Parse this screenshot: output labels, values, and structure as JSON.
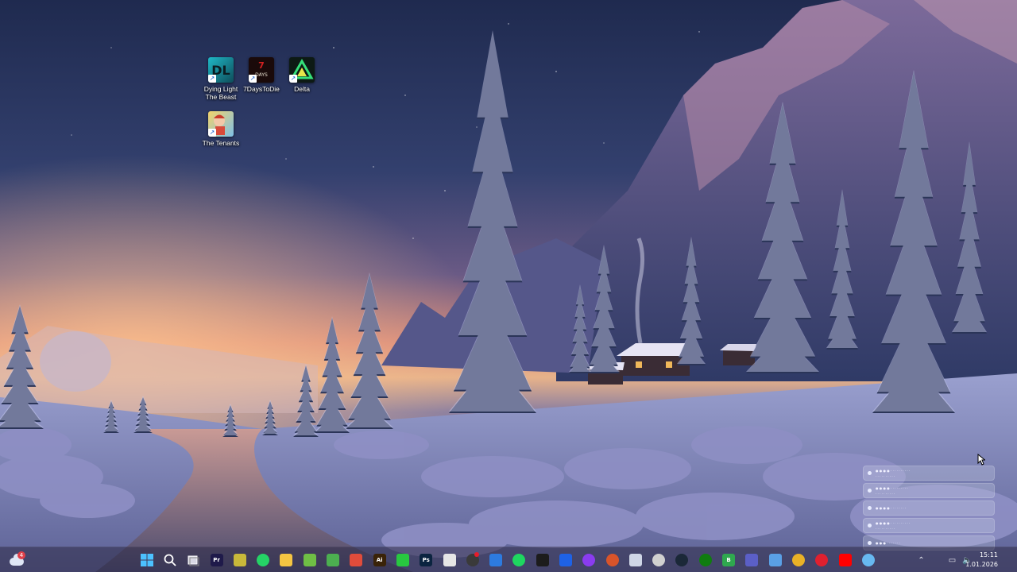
{
  "desktop": {
    "icons": [
      {
        "label": "Dying Light\nThe Beast",
        "label_line1": "Dying Light",
        "label_line2": "The Beast",
        "icon": "dying-light-icon"
      },
      {
        "label": "7DaysToDie",
        "icon": "7-days-to-die-icon"
      },
      {
        "label": "Delta",
        "icon": "delta-icon"
      },
      {
        "label": "The Tenants",
        "icon": "the-tenants-icon"
      }
    ]
  },
  "notifications": {
    "rows": [
      {
        "line1": "● ● ● ● · · · · · · · · · ·",
        "line2": "· · · · · · · · · ·"
      },
      {
        "line1": "● ● ● ● · · · · · · · · ·",
        "line2": "· · · · · · · · · ·"
      },
      {
        "line1": "● ● ● ● · · · · · · · ·",
        "line2": ""
      },
      {
        "line1": "● ● ● ● · · · · · · · · · ·",
        "line2": "· · · · · · · · · ·"
      },
      {
        "line1": "● ● ● · · · · · · ·",
        "line2": ""
      }
    ]
  },
  "taskbar": {
    "weather_badge": "4",
    "pinned": [
      {
        "name": "start-icon",
        "color": "#3fa4f0",
        "text": ""
      },
      {
        "name": "search-icon",
        "color": "transparent",
        "text": ""
      },
      {
        "name": "task-view-icon",
        "color": "transparent",
        "text": ""
      },
      {
        "name": "premiere-pro-icon",
        "color": "#1f1a4a",
        "text": "Pr"
      },
      {
        "name": "app-green-icon",
        "color": "#c9b93a",
        "text": ""
      },
      {
        "name": "whatsapp-icon",
        "color": "#25d366",
        "text": ""
      },
      {
        "name": "file-explorer-icon",
        "color": "#f5c542",
        "text": ""
      },
      {
        "name": "xbox-game-icon",
        "color": "#6fbf45",
        "text": ""
      },
      {
        "name": "app-lime-icon",
        "color": "#4caf50",
        "text": ""
      },
      {
        "name": "app-red-icon",
        "color": "#e04c3b",
        "text": ""
      },
      {
        "name": "illustrator-icon",
        "color": "#3a2308",
        "text": "Ai"
      },
      {
        "name": "phone-link-icon",
        "color": "#28c840",
        "text": ""
      },
      {
        "name": "photoshop-icon",
        "color": "#0b2440",
        "text": "Ps"
      },
      {
        "name": "app-document-icon",
        "color": "#e6e6e6",
        "text": ""
      },
      {
        "name": "app-dark-icon",
        "color": "#3a3a3a",
        "text": ""
      },
      {
        "name": "app-blue-icon",
        "color": "#2d7be0",
        "text": ""
      },
      {
        "name": "spotify-icon",
        "color": "#1ed760",
        "text": ""
      },
      {
        "name": "capcut-icon",
        "color": "#1c1c1c",
        "text": ""
      },
      {
        "name": "app-dropbox-icon",
        "color": "#1e62e6",
        "text": ""
      },
      {
        "name": "app-purple-icon",
        "color": "#8a3cf0",
        "text": ""
      },
      {
        "name": "app-orange-icon",
        "color": "#d9542a",
        "text": ""
      },
      {
        "name": "app-white-icon",
        "color": "#cfd6e6",
        "text": ""
      },
      {
        "name": "app-ring-icon",
        "color": "#d0d0d0",
        "text": ""
      },
      {
        "name": "steam-icon",
        "color": "#1b2838",
        "text": ""
      },
      {
        "name": "xbox-icon",
        "color": "#107c10",
        "text": ""
      },
      {
        "name": "app-b-icon",
        "color": "#2fa84f",
        "text": "B"
      },
      {
        "name": "teams-icon",
        "color": "#5b5fc7",
        "text": ""
      },
      {
        "name": "app-cloud-icon",
        "color": "#5aa0e6",
        "text": ""
      },
      {
        "name": "chrome-icon",
        "color": "#e9b127",
        "text": ""
      },
      {
        "name": "opera-icon",
        "color": "#e0202f",
        "text": ""
      },
      {
        "name": "youtube-icon",
        "color": "#ff0000",
        "text": ""
      },
      {
        "name": "app-light-blue-icon",
        "color": "#67b8f0",
        "text": ""
      }
    ],
    "tray": {
      "chevron": "⌃",
      "network": "▭",
      "volume": "🔈"
    },
    "clock": {
      "time": "15:11",
      "date": "1.01.2026"
    }
  }
}
